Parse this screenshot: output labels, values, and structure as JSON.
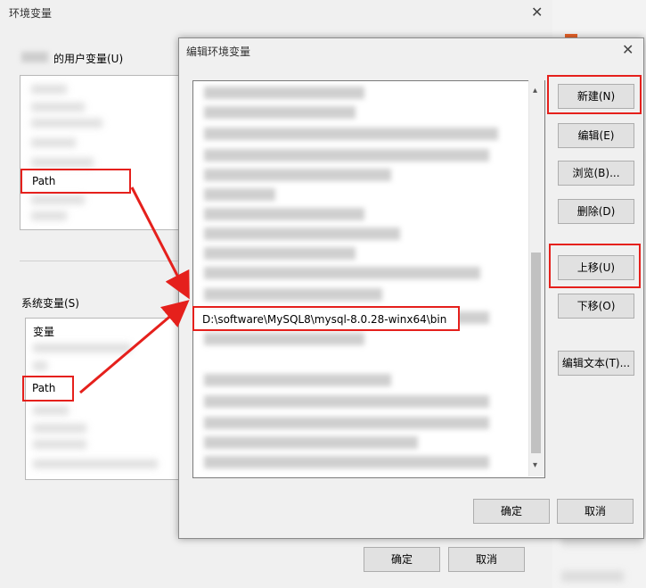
{
  "background_window": {
    "title": "环境变量",
    "user_vars_label": "的用户变量(U)",
    "user_path": "Path",
    "system_vars_label": "系统变量(S)",
    "system_col_header": "变量",
    "system_path": "Path",
    "ok": "确定",
    "cancel": "取消"
  },
  "dialog": {
    "title": "编辑环境变量",
    "highlighted_entry": "D:\\software\\MySQL8\\mysql-8.0.28-winx64\\bin",
    "buttons": {
      "new": "新建(N)",
      "edit": "编辑(E)",
      "browse": "浏览(B)...",
      "delete": "删除(D)",
      "move_up": "上移(U)",
      "move_down": "下移(O)",
      "edit_text": "编辑文本(T)...",
      "ok": "确定",
      "cancel": "取消"
    }
  },
  "colors": {
    "annotation_red": "#e5201c"
  }
}
